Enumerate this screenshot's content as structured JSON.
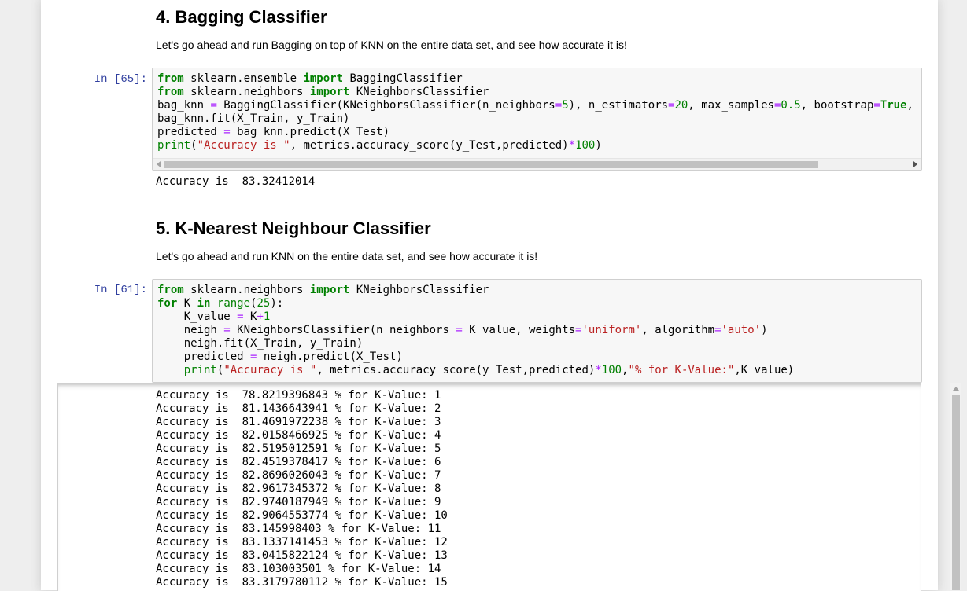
{
  "section4": {
    "heading": "4. Bagging Classifier",
    "description": "Let's go ahead and run Bagging on top of KNN on the entire data set, and see how accurate it is!"
  },
  "cell65": {
    "prompt": "In [65]:",
    "output": "Accuracy is  83.32412014"
  },
  "section5": {
    "heading": "5. K-Nearest Neighbour Classifier",
    "description": "Let's go ahead and run KNN on the entire data set, and see how accurate it is!"
  },
  "cell61": {
    "prompt": "In [61]:",
    "output_lines": [
      "Accuracy is  78.8219396843 % for K-Value: 1",
      "Accuracy is  81.1436643941 % for K-Value: 2",
      "Accuracy is  81.4691972238 % for K-Value: 3",
      "Accuracy is  82.0158466925 % for K-Value: 4",
      "Accuracy is  82.5195012591 % for K-Value: 5",
      "Accuracy is  82.4519378417 % for K-Value: 6",
      "Accuracy is  82.8696026043 % for K-Value: 7",
      "Accuracy is  82.9617345372 % for K-Value: 8",
      "Accuracy is  82.9740187949 % for K-Value: 9",
      "Accuracy is  82.9064553774 % for K-Value: 10",
      "Accuracy is  83.145998403 % for K-Value: 11",
      "Accuracy is  83.1337141453 % for K-Value: 12",
      "Accuracy is  83.0415822124 % for K-Value: 13",
      "Accuracy is  83.103003501 % for K-Value: 14",
      "Accuracy is  83.3179780112 % for K-Value: 15"
    ]
  },
  "code65": [
    [
      [
        "kw",
        "from"
      ],
      [
        "t",
        " sklearn.ensemble "
      ],
      [
        "kw",
        "import"
      ],
      [
        "t",
        " BaggingClassifier"
      ]
    ],
    [
      [
        "kw",
        "from"
      ],
      [
        "t",
        " sklearn.neighbors "
      ],
      [
        "kw",
        "import"
      ],
      [
        "t",
        " KNeighborsClassifier"
      ]
    ],
    [
      [
        "t",
        "bag_knn "
      ],
      [
        "op",
        "="
      ],
      [
        "t",
        " BaggingClassifier(KNeighborsClassifier(n_neighbors"
      ],
      [
        "op",
        "="
      ],
      [
        "num",
        "5"
      ],
      [
        "t",
        "), n_estimators"
      ],
      [
        "op",
        "="
      ],
      [
        "num",
        "20"
      ],
      [
        "t",
        ", max_samples"
      ],
      [
        "op",
        "="
      ],
      [
        "num",
        "0.5"
      ],
      [
        "t",
        ", bootstrap"
      ],
      [
        "op",
        "="
      ],
      [
        "kw",
        "True"
      ],
      [
        "t",
        ","
      ]
    ],
    [
      [
        "t",
        "bag_knn.fit(X_Train, y_Train)"
      ]
    ],
    [
      [
        "t",
        "predicted "
      ],
      [
        "op",
        "="
      ],
      [
        "t",
        " bag_knn.predict(X_Test)"
      ]
    ],
    [
      [
        "bi",
        "print"
      ],
      [
        "t",
        "("
      ],
      [
        "str",
        "\"Accuracy is \""
      ],
      [
        "t",
        ", metrics.accuracy_score(y_Test,predicted)"
      ],
      [
        "op",
        "*"
      ],
      [
        "num",
        "100"
      ],
      [
        "t",
        ")"
      ]
    ]
  ],
  "code61": [
    [
      [
        "kw",
        "from"
      ],
      [
        "t",
        " sklearn.neighbors "
      ],
      [
        "kw",
        "import"
      ],
      [
        "t",
        " KNeighborsClassifier"
      ]
    ],
    [
      [
        "kw",
        "for"
      ],
      [
        "t",
        " K "
      ],
      [
        "kw",
        "in"
      ],
      [
        "t",
        " "
      ],
      [
        "bi",
        "range"
      ],
      [
        "t",
        "("
      ],
      [
        "num",
        "25"
      ],
      [
        "t",
        "):"
      ]
    ],
    [
      [
        "t",
        "    K_value "
      ],
      [
        "op",
        "="
      ],
      [
        "t",
        " K"
      ],
      [
        "op",
        "+"
      ],
      [
        "num",
        "1"
      ]
    ],
    [
      [
        "t",
        "    neigh "
      ],
      [
        "op",
        "="
      ],
      [
        "t",
        " KNeighborsClassifier(n_neighbors "
      ],
      [
        "op",
        "="
      ],
      [
        "t",
        " K_value, weights"
      ],
      [
        "op",
        "="
      ],
      [
        "str",
        "'uniform'"
      ],
      [
        "t",
        ", algorithm"
      ],
      [
        "op",
        "="
      ],
      [
        "str",
        "'auto'"
      ],
      [
        "t",
        ")"
      ]
    ],
    [
      [
        "t",
        "    neigh.fit(X_Train, y_Train)"
      ]
    ],
    [
      [
        "t",
        "    predicted "
      ],
      [
        "op",
        "="
      ],
      [
        "t",
        " neigh.predict(X_Test)"
      ]
    ],
    [
      [
        "t",
        "    "
      ],
      [
        "bi",
        "print"
      ],
      [
        "t",
        "("
      ],
      [
        "str",
        "\"Accuracy is \""
      ],
      [
        "t",
        ", metrics.accuracy_score(y_Test,predicted)"
      ],
      [
        "op",
        "*"
      ],
      [
        "num",
        "100"
      ],
      [
        "t",
        ","
      ],
      [
        "str",
        "\"% for K-Value:\""
      ],
      [
        "t",
        ",K_value)"
      ]
    ]
  ]
}
